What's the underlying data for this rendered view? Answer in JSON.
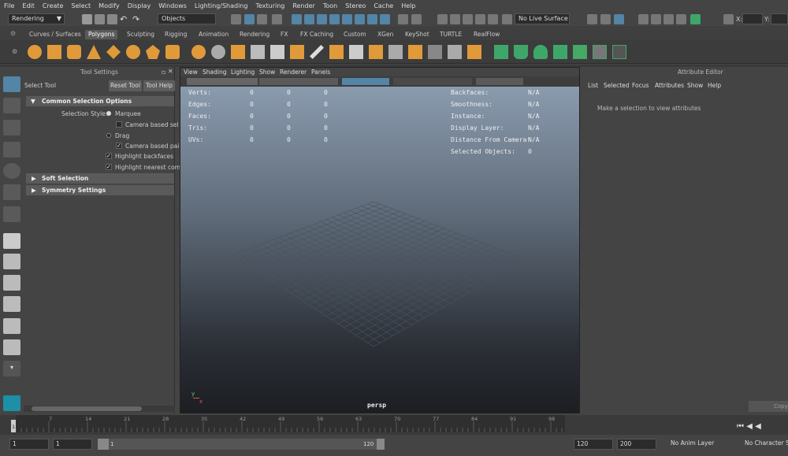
{
  "menubar": [
    "File",
    "Edit",
    "Create",
    "Select",
    "Modify",
    "Display",
    "Windows",
    "Lighting/Shading",
    "Texturing",
    "Render",
    "Toon",
    "Stereo",
    "Cache",
    "Help"
  ],
  "statusline": {
    "menuset": "Rendering",
    "objects": "Objects",
    "live_surface": "No Live Surface",
    "x_label": "X:",
    "y_label": "Y:"
  },
  "shelf_tabs": [
    "Curves / Surfaces",
    "Polygons",
    "Sculpting",
    "Rigging",
    "Animation",
    "Rendering",
    "FX",
    "FX Caching",
    "Custom",
    "XGen",
    "KeyShot",
    "TURTLE",
    "RealFlow"
  ],
  "tool_settings": {
    "panel_title": "Tool Settings",
    "tool_name": "Select Tool",
    "reset_button": "Reset Tool",
    "help_button": "Tool Help",
    "section_common": "Common Selection Options",
    "selection_style_label": "Selection Style:",
    "marquee": "Marquee",
    "camera_based_sel": "Camera based sel",
    "drag": "Drag",
    "camera_based_paint": "Camera based pai",
    "highlight_backfaces": "Highlight backfaces",
    "highlight_nearest": "Highlight nearest com",
    "section_soft": "Soft Selection",
    "section_symmetry": "Symmetry Settings"
  },
  "viewport": {
    "menu": [
      "View",
      "Shading",
      "Lighting",
      "Show",
      "Renderer",
      "Panels"
    ],
    "hud_left": [
      {
        "label": "Verts:",
        "v1": "0",
        "v2": "0",
        "v3": "0"
      },
      {
        "label": "Edges:",
        "v1": "0",
        "v2": "0",
        "v3": "0"
      },
      {
        "label": "Faces:",
        "v1": "0",
        "v2": "0",
        "v3": "0"
      },
      {
        "label": "Tris:",
        "v1": "0",
        "v2": "0",
        "v3": "0"
      },
      {
        "label": "UVs:",
        "v1": "0",
        "v2": "0",
        "v3": "0"
      }
    ],
    "hud_right": [
      {
        "label": "Backfaces:",
        "value": "N/A"
      },
      {
        "label": "Smoothness:",
        "value": "N/A"
      },
      {
        "label": "Instance:",
        "value": "N/A"
      },
      {
        "label": "Display Layer:",
        "value": "N/A"
      },
      {
        "label": "Distance From Camera:",
        "value": "N/A"
      },
      {
        "label": "Selected Objects:",
        "value": "0"
      }
    ],
    "camera_name": "persp",
    "axis_y": "y",
    "axis_x": "x"
  },
  "attribute_editor": {
    "title": "Attribute Editor",
    "menu": [
      "List",
      "Selected",
      "Focus",
      "Attributes",
      "Show",
      "Help"
    ],
    "empty_message": "Make a selection to view attributes"
  },
  "timeline": {
    "ticks": [
      "1",
      "7",
      "14",
      "21",
      "28",
      "35",
      "42",
      "49",
      "56",
      "63",
      "70",
      "77",
      "84",
      "91",
      "98"
    ],
    "current_frame_marker": "1",
    "copy_label": "Copy"
  },
  "range": {
    "start": "1",
    "playback_start": "1",
    "slider_start": "1",
    "slider_end": "120",
    "playback_end": "120",
    "end": "200",
    "anim_layer": "No Anim Layer",
    "char_set": "No Character Se"
  },
  "colors": {
    "accent": "#f0a030",
    "shelf_green": "#3fa66a",
    "highlight_blue": "#5285a6"
  }
}
